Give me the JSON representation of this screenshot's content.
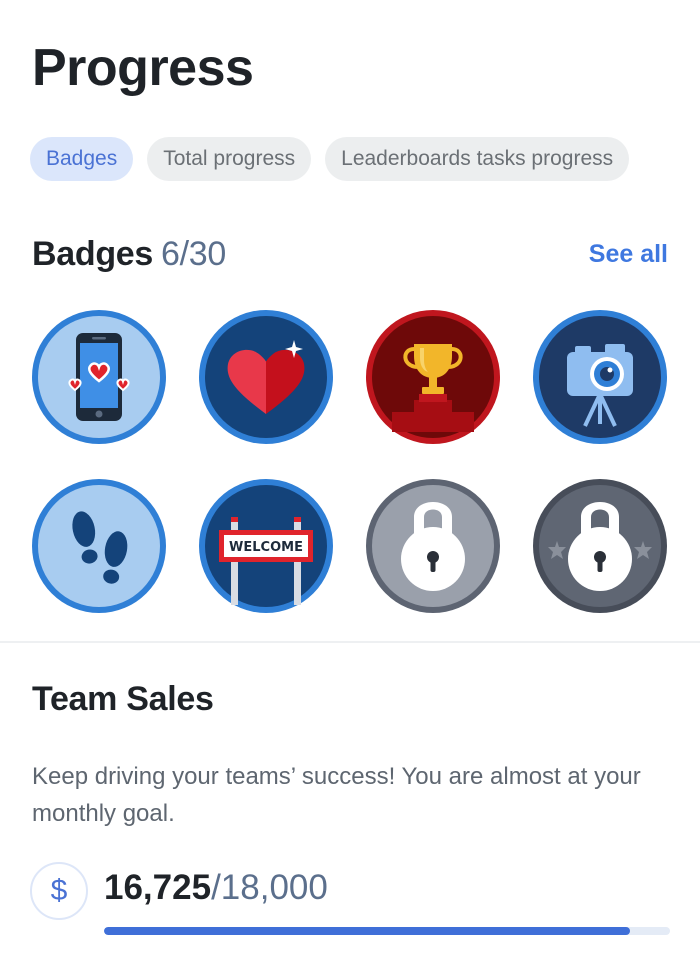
{
  "page": {
    "title": "Progress"
  },
  "tabs": [
    {
      "label": "Badges",
      "active": true
    },
    {
      "label": "Total progress",
      "active": false
    },
    {
      "label": "Leaderboards tasks progress",
      "active": false
    }
  ],
  "badges": {
    "title": "Badges",
    "count": "6/30",
    "see_all": "See all",
    "items": [
      {
        "icon": "phone-hearts-icon",
        "unlocked": true
      },
      {
        "icon": "heart-icon",
        "unlocked": true
      },
      {
        "icon": "trophy-icon",
        "unlocked": true
      },
      {
        "icon": "camera-icon",
        "unlocked": true
      },
      {
        "icon": "footprints-icon",
        "unlocked": true
      },
      {
        "icon": "welcome-sign-icon",
        "unlocked": true,
        "sign_text": "WELCOME"
      },
      {
        "icon": "lock-icon",
        "unlocked": false
      },
      {
        "icon": "lock-icon",
        "unlocked": false
      }
    ]
  },
  "team_sales": {
    "title": "Team Sales",
    "description": "Keep driving your teams’ success! You are almost at your monthly goal.",
    "currency_symbol": "$",
    "current": "16,725",
    "separator": "/",
    "goal": "18,000",
    "progress_fraction": 0.929
  },
  "colors": {
    "accent": "#3f78e0",
    "progress_fill": "#3f6fd8",
    "progress_track": "#e4ebf6",
    "active_chip_bg": "#dbe6fb"
  }
}
